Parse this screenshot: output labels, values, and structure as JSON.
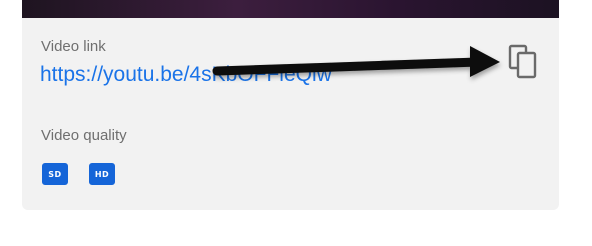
{
  "video_link": {
    "label": "Video link",
    "value": "https://youtu.be/4sKbOFFleQiw"
  },
  "video_quality": {
    "label": "Video quality",
    "options": [
      "SD",
      "HD"
    ]
  },
  "icons": {
    "copy": "copy-icon",
    "arrow": "arrow-icon"
  },
  "colors": {
    "link": "#1a73e8",
    "quality_badge": "#1565d8",
    "card_background": "#f2f2f2"
  }
}
